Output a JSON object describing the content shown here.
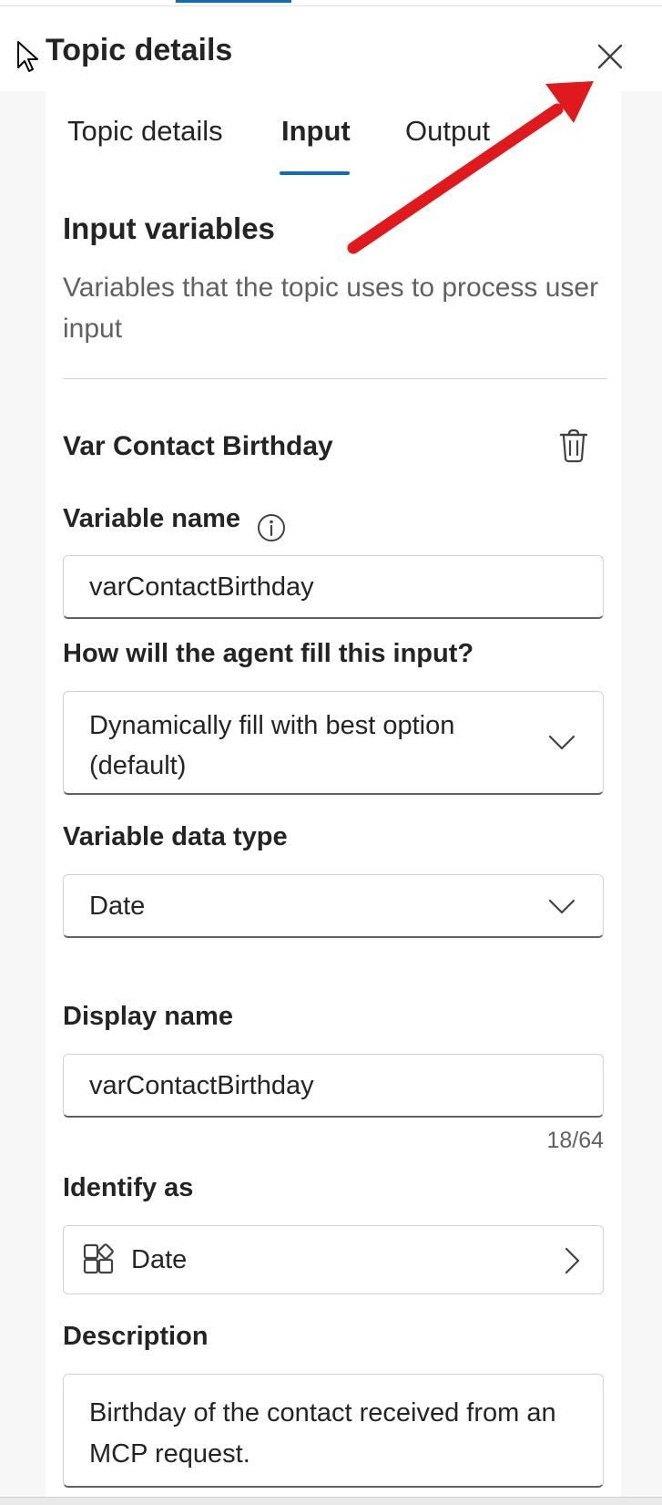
{
  "panel": {
    "title": "Topic details",
    "close_icon": "close-icon"
  },
  "tabs": [
    {
      "label": "Topic details",
      "active": false
    },
    {
      "label": "Input",
      "active": true
    },
    {
      "label": "Output",
      "active": false
    }
  ],
  "section": {
    "title": "Input variables",
    "subtitle": "Variables that the topic uses to process user input"
  },
  "variable": {
    "heading": "Var Contact Birthday",
    "name_label": "Variable name",
    "name_value": "varContactBirthday",
    "fill_label": "How will the agent fill this input?",
    "fill_value": "Dynamically fill with best option (default)",
    "type_label": "Variable data type",
    "type_value": "Date",
    "display_label": "Display name",
    "display_value": "varContactBirthday",
    "display_counter": "18/64",
    "identify_label": "Identify as",
    "identify_value": "Date",
    "description_label": "Description",
    "description_value": "Birthday of the contact received from an MCP request."
  },
  "colors": {
    "accent": "#0f6cbd",
    "annotation_arrow": "#e0191d",
    "text": "#242424",
    "muted": "#616161"
  }
}
